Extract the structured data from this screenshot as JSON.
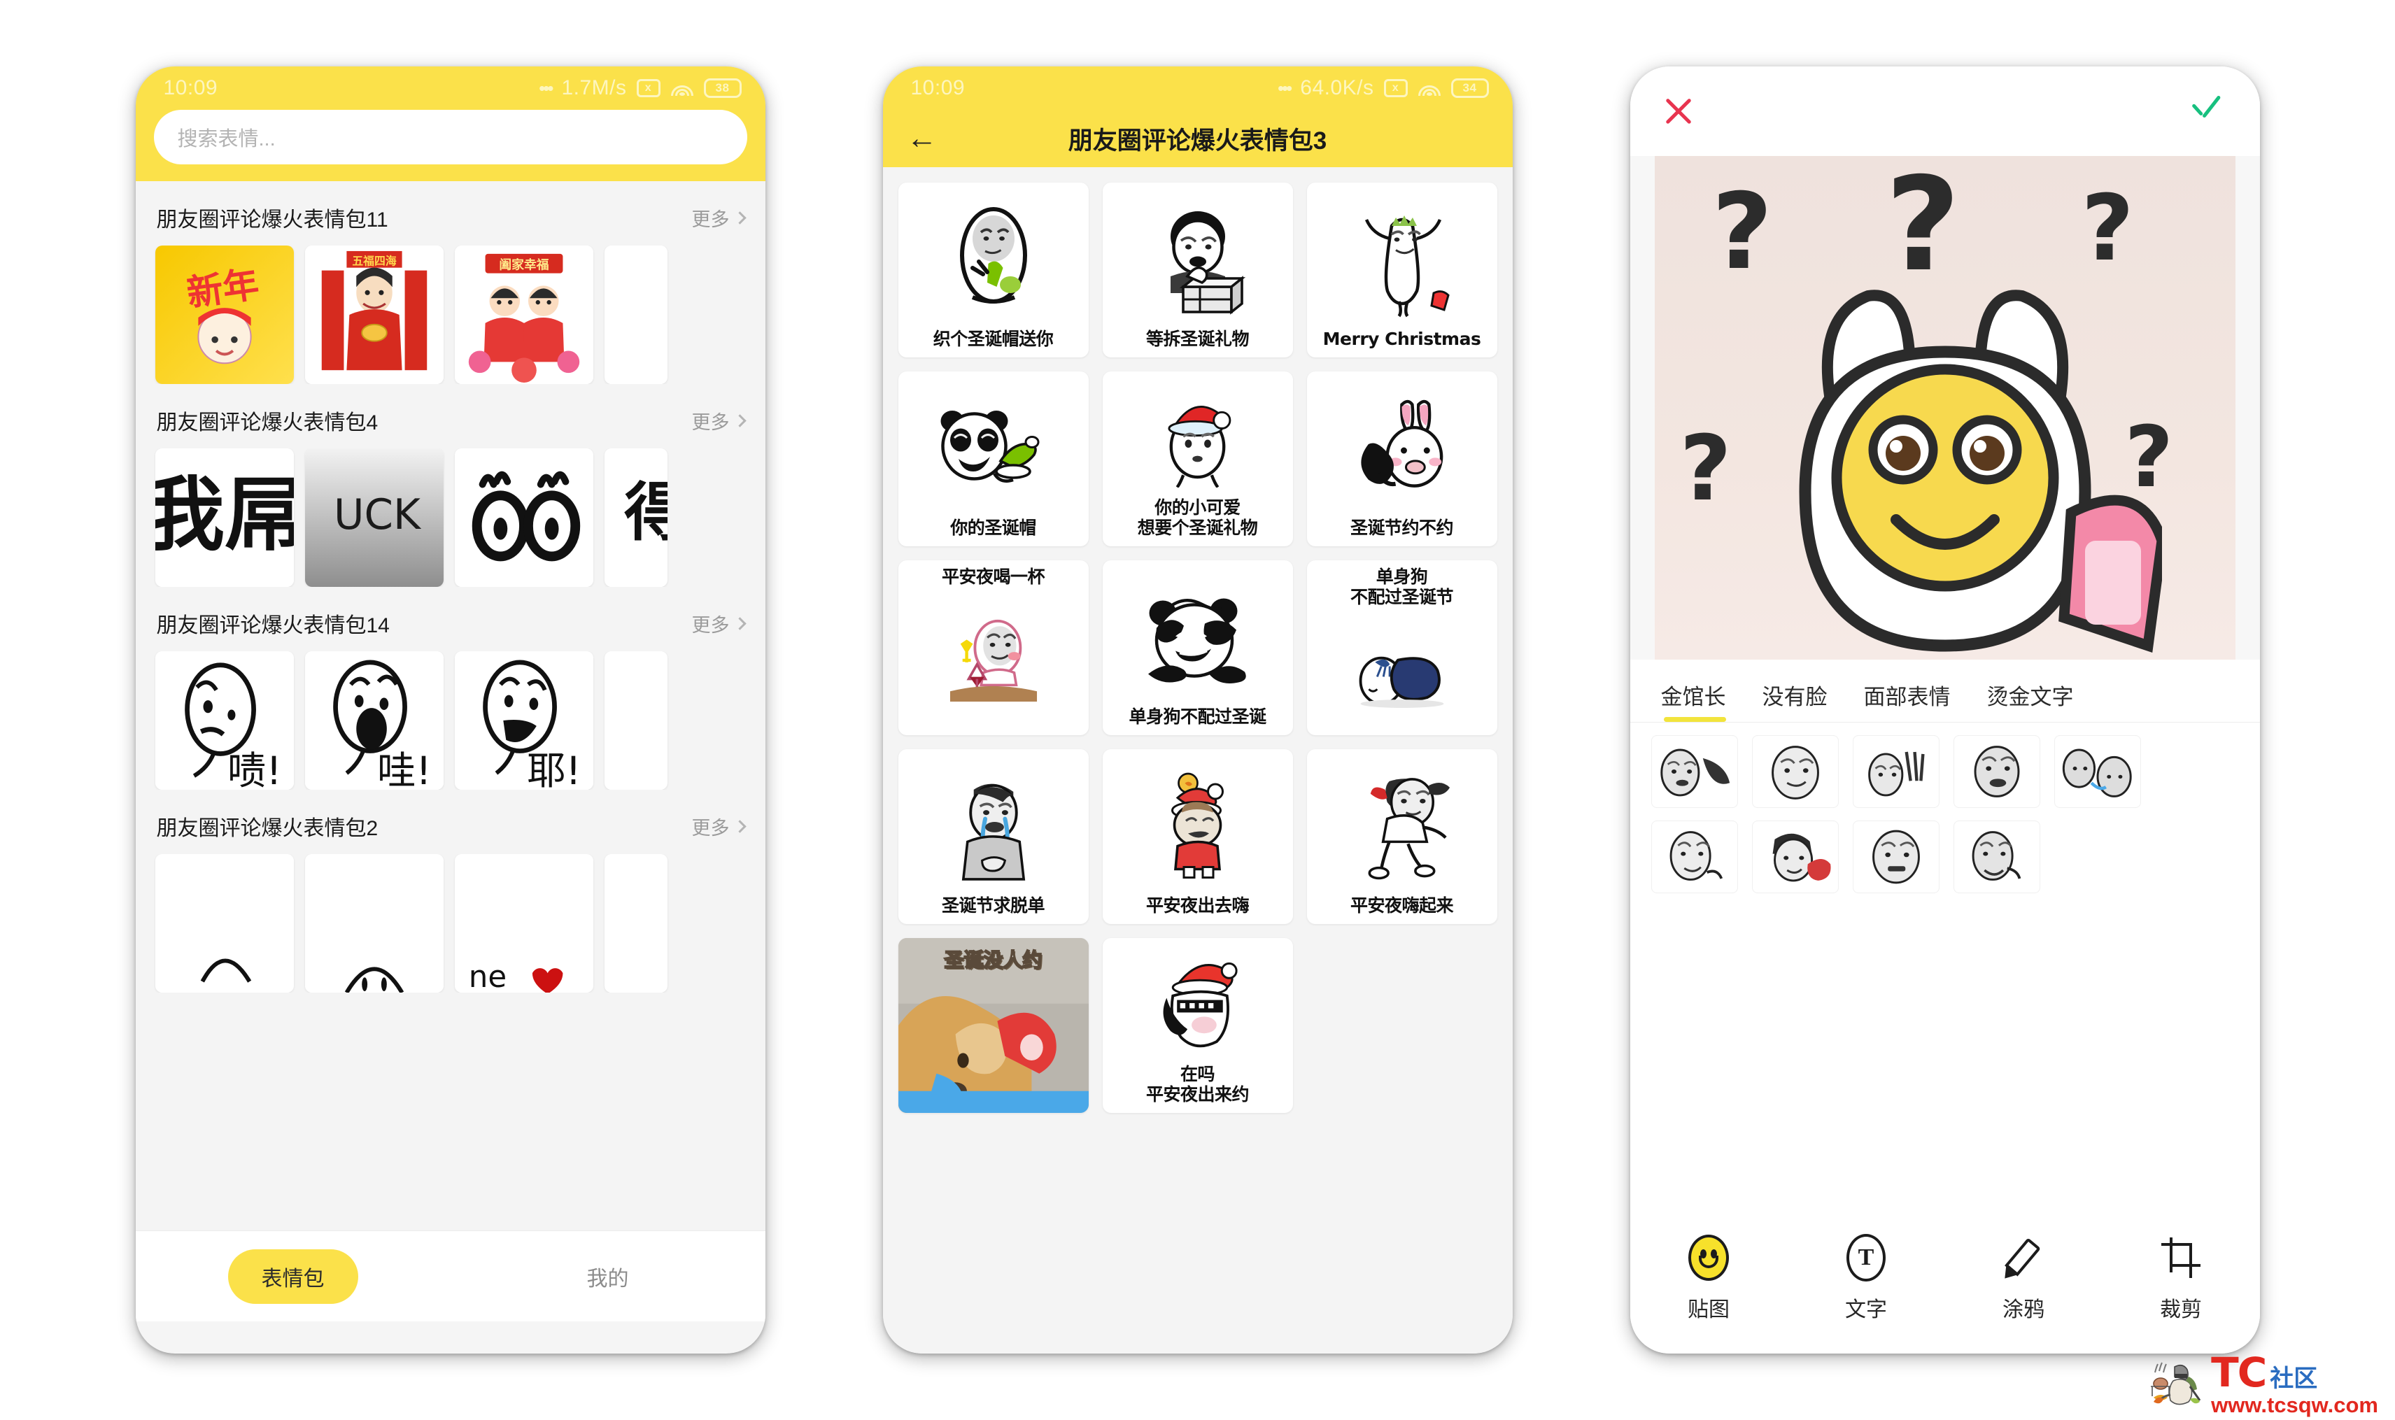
{
  "app": {
    "accent_yellow": "#fbe14a",
    "bg_gray": "#f4f4f4",
    "cancel_red": "#e8344f",
    "confirm_green": "#17c07f"
  },
  "phone1": {
    "status": {
      "time": "10:09",
      "dots": "•••",
      "net_speed": "1.7M/s",
      "cast_icon": "screencast-icon",
      "wifi_icon": "wifi-icon",
      "battery_icon": "battery-icon",
      "battery_level": "38"
    },
    "search": {
      "placeholder": "搜索表情..."
    },
    "more_label": "更多",
    "sections": [
      {
        "title": "朋友圈评论爆火表情包11",
        "stickers": [
          "新年快乐红底",
          "五福四海财神",
          "阖家幸福"
        ]
      },
      {
        "title": "朋友圈评论爆火表情包4",
        "stickers": [
          "我屌",
          "UCK",
          "OO眼镜",
          "得"
        ]
      },
      {
        "title": "朋友圈评论爆火表情包14",
        "stickers": [
          "啧!",
          "哇!",
          "耶!",
          "—"
        ]
      },
      {
        "title": "朋友圈评论爆火表情包2",
        "stickers": [
          "弧线脸",
          "点点脸",
          "ne ♥",
          "—"
        ]
      }
    ],
    "tabs": [
      {
        "label": "表情包",
        "active": true
      },
      {
        "label": "我的",
        "active": false
      }
    ]
  },
  "phone2": {
    "status": {
      "time": "10:09",
      "dots": "•••",
      "net_speed": "64.0K/s",
      "cast_icon": "screencast-icon",
      "wifi_icon": "wifi-icon",
      "battery_icon": "battery-icon",
      "battery_level": "34"
    },
    "back_icon": "back-arrow-icon",
    "title": "朋友圈评论爆火表情包3",
    "stickers": [
      {
        "caption": "织个圣诞帽送你",
        "art": "egg-face-green-hat"
      },
      {
        "caption": "等拆圣诞礼物",
        "art": "man-gift-box"
      },
      {
        "caption": "Merry Christmas",
        "art": "white-figure-arms-up"
      },
      {
        "caption": "你的圣诞帽",
        "art": "panda-green-hat"
      },
      {
        "caption": "你的小可爱\n想要个圣诞礼物",
        "art": "egg-santa-hat"
      },
      {
        "caption": "圣诞节约不约",
        "art": "rabbit-phone"
      },
      {
        "caption": "平安夜喝一杯",
        "art": "egg-wine-glass"
      },
      {
        "caption": "单身狗不配过圣诞",
        "art": "panda-facepalm"
      },
      {
        "caption": "单身狗\n不配过圣诞节",
        "art": "sleeping-blanket"
      },
      {
        "caption": "圣诞节求脱单",
        "art": "crying-man"
      },
      {
        "caption": "平安夜出去嗨",
        "art": "santa-kid-chick"
      },
      {
        "caption": "平安夜嗨起来",
        "art": "dabbing-figure"
      },
      {
        "caption": "圣诞没人约",
        "art": "corgi-photo",
        "overlay": true
      },
      {
        "caption": "在吗\n平安夜出来约",
        "art": "thug-santa"
      }
    ]
  },
  "phone3": {
    "cancel_icon": "close-icon",
    "confirm_icon": "check-icon",
    "canvas": {
      "art": "bunny-phone-question-marks",
      "question_mark": "?"
    },
    "tabs": [
      {
        "label": "金馆长",
        "active": true
      },
      {
        "label": "没有脸",
        "active": false
      },
      {
        "label": "面部表情",
        "active": false
      },
      {
        "label": "烫金文字",
        "active": false
      }
    ],
    "sticker_rows": [
      [
        "sticker-1",
        "sticker-2",
        "sticker-3",
        "sticker-4",
        "sticker-5"
      ],
      [
        "sticker-6",
        "sticker-7",
        "sticker-8",
        "sticker-9"
      ]
    ],
    "tools": [
      {
        "label": "贴图",
        "icon": "smiley-icon",
        "active": true
      },
      {
        "label": "文字",
        "icon": "text-icon",
        "active": false
      },
      {
        "label": "涂鸦",
        "icon": "pencil-icon",
        "active": false
      },
      {
        "label": "裁剪",
        "icon": "crop-icon",
        "active": false
      }
    ]
  },
  "watermark": {
    "brand": "TC",
    "community": "社区",
    "url": "www.tcsqw.com",
    "mascot_icon": "pubg-mascot-icon"
  }
}
